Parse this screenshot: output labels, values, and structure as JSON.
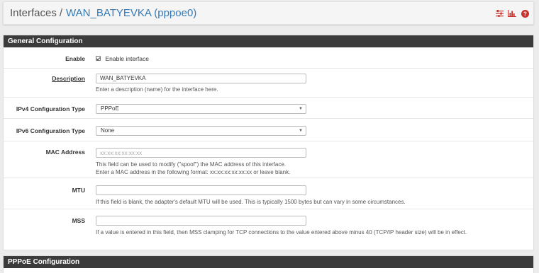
{
  "header": {
    "breadcrumb_parent": "Interfaces",
    "separator": "/",
    "breadcrumb_current": "WAN_BATYEVKA (pppoe0)",
    "icons": [
      "sliders-icon",
      "bar-chart-icon",
      "help-icon"
    ],
    "icon_color": "#c9302c"
  },
  "general": {
    "heading": "General Configuration",
    "enable_label": "Enable",
    "enable_checkbox_label": "Enable interface",
    "enable_checked": true,
    "description_label": "Description",
    "description_value": "WAN_BATYEVKA",
    "description_help": "Enter a description (name) for the interface here.",
    "ipv4_label": "IPv4 Configuration Type",
    "ipv4_value": "PPPoE",
    "ipv6_label": "IPv6 Configuration Type",
    "ipv6_value": "None",
    "mac_label": "MAC Address",
    "mac_placeholder": "xx:xx:xx:xx:xx:xx",
    "mac_help_1": "This field can be used to modify (\"spoof\") the MAC address of this interface.",
    "mac_help_2": "Enter a MAC address in the following format: xx:xx:xx:xx:xx:xx or leave blank.",
    "mtu_label": "MTU",
    "mtu_help": "If this field is blank, the adapter's default MTU will be used. This is typically 1500 bytes but can vary in some circumstances.",
    "mss_label": "MSS",
    "mss_help": "If a value is entered in this field, then MSS clamping for TCP connections to the value entered above minus 40 (TCP/IP header size) will be in effect."
  },
  "pppoe": {
    "heading": "PPPoE Configuration"
  }
}
